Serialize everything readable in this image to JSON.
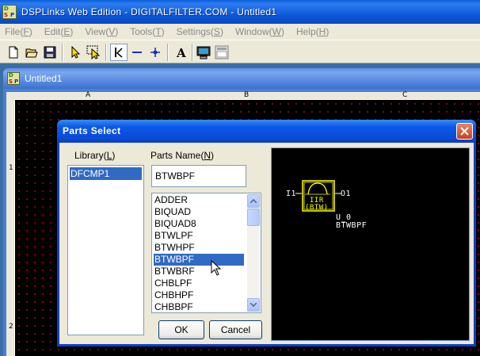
{
  "app": {
    "title": "DSPLinks Web Edition - DIGITALFILTER.COM - Untitled1",
    "logo_letters": [
      "D",
      "S",
      "P"
    ]
  },
  "menubar": [
    {
      "label": "File",
      "key": "F"
    },
    {
      "label": "Edit",
      "key": "E"
    },
    {
      "label": "View",
      "key": "V"
    },
    {
      "label": "Tools",
      "key": "T"
    },
    {
      "label": "Settings",
      "key": "S"
    },
    {
      "label": "Window",
      "key": "W"
    },
    {
      "label": "Help",
      "key": "H"
    }
  ],
  "toolbar": {
    "icons": [
      "new-file-icon",
      "open-folder-icon",
      "save-icon",
      "select-pointer-icon",
      "select-area-icon",
      "wire-tool-icon",
      "line-tool-icon",
      "junction-tool-icon",
      "text-tool-icon",
      "monitor-icon",
      "properties-icon"
    ]
  },
  "document": {
    "title": "Untitled1",
    "column_labels": [
      "A",
      "B",
      "C"
    ],
    "row_labels": [
      "1",
      "2"
    ]
  },
  "dialog": {
    "title": "Parts Select",
    "library_label": "Library(",
    "library_key": "L",
    "library_label_end": ")",
    "parts_name_label": "Parts Name(",
    "parts_name_key": "N",
    "parts_name_label_end": ")",
    "libraries": [
      "DFCMP1"
    ],
    "selected_library": "DFCMP1",
    "parts_name_value": "BTWBPF",
    "parts": [
      "ADDER",
      "BIQUAD",
      "BIQUAD8",
      "BTWLPF",
      "BTWHPF",
      "BTWBPF",
      "BTWBRF",
      "CHBLPF",
      "CHBHPF",
      "CHBBPF"
    ],
    "selected_part": "BTWBPF",
    "ok_label": "OK",
    "cancel_label": "Cancel",
    "preview": {
      "input_pin": "I1",
      "output_pin": "O1",
      "block_line1": "IIR",
      "block_line2": "(BTW)",
      "instance_name": "U_0",
      "part_name": "BTWBPF"
    }
  },
  "colors": {
    "title_bar": "#0a55d6",
    "selection": "#316ac5",
    "schematic_bg": "#000000",
    "grid_dot": "#a01010",
    "symbol": "#ffff00"
  }
}
